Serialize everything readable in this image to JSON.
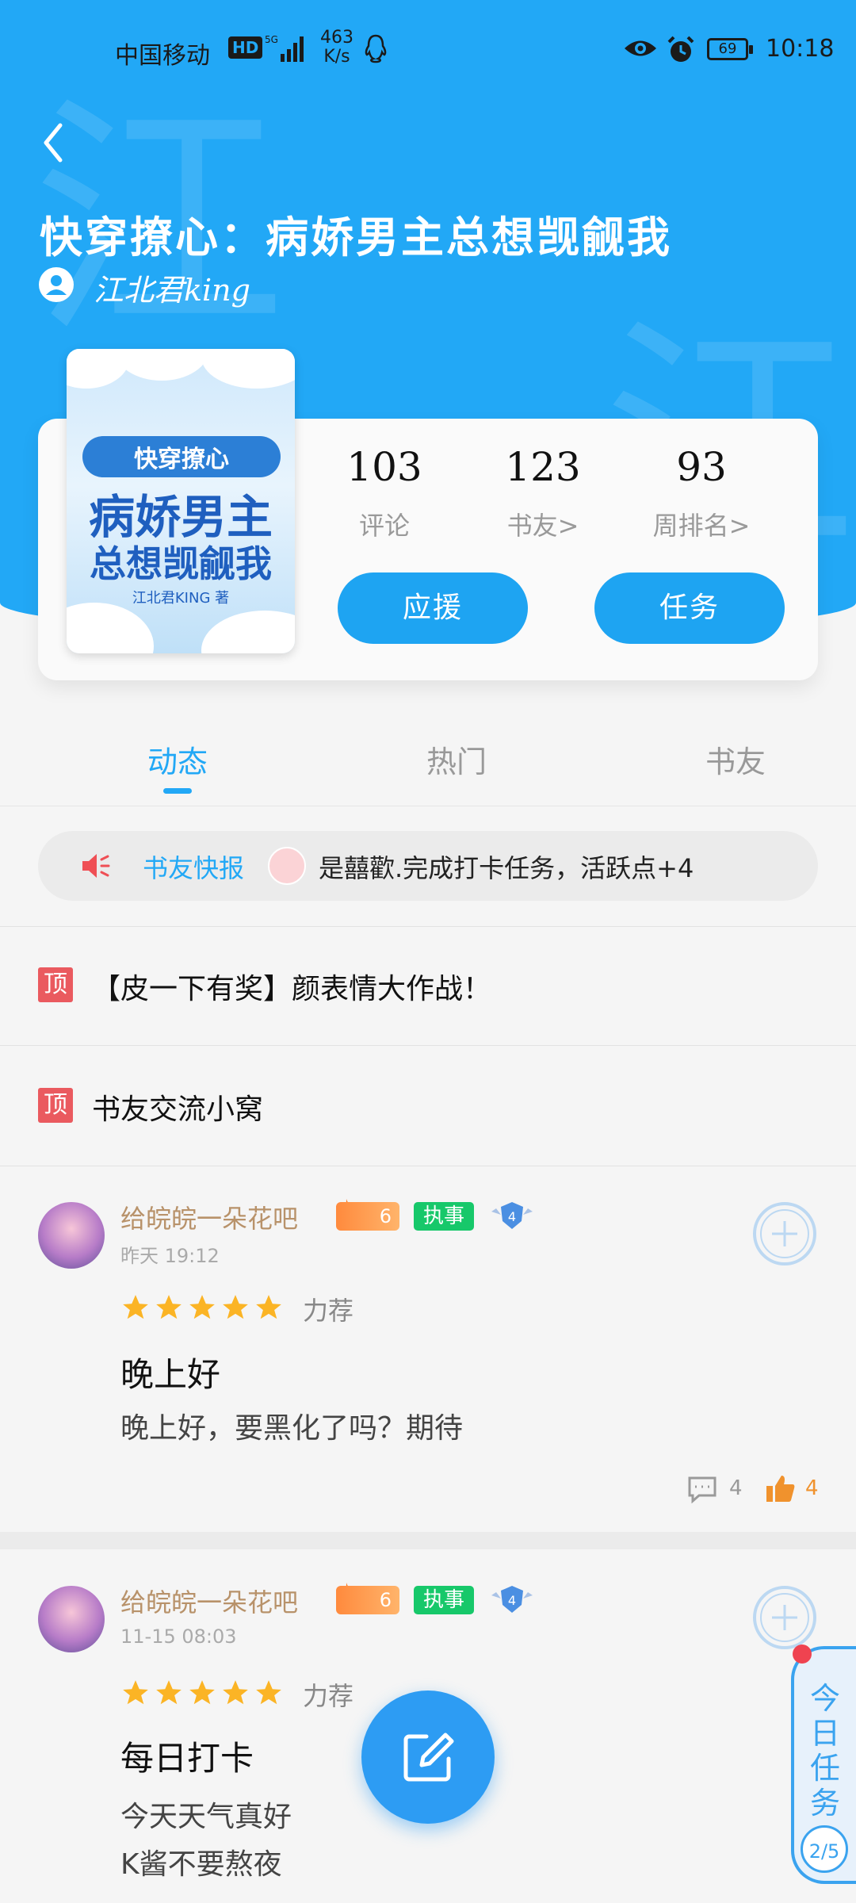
{
  "status_bar": {
    "carrier": "中国移动",
    "hd": "HD",
    "network_speed_value": "463",
    "network_speed_unit": "K/s",
    "battery": "69",
    "time": "10:18"
  },
  "book": {
    "title": "快穿撩心：病娇男主总想觊觎我",
    "author": "江北君king",
    "cover": {
      "line1": "快穿撩心",
      "line2": "病娇男主",
      "line3": "总想觊觎我",
      "line4": "江北君KING 著"
    }
  },
  "stats": [
    {
      "value": "103",
      "label": "评论"
    },
    {
      "value": "123",
      "label": "书友>"
    },
    {
      "value": "93",
      "label": "周排名>"
    }
  ],
  "actions": {
    "support_label": "应援",
    "task_label": "任务"
  },
  "tabs": [
    {
      "label": "动态",
      "active": true
    },
    {
      "label": "热门",
      "active": false
    },
    {
      "label": "书友",
      "active": false
    }
  ],
  "news": {
    "title": "书友快报",
    "text": "是囍歡.完成打卡任务，活跃点+4"
  },
  "pinned": [
    {
      "badge": "顶",
      "text": "【皮一下有奖】颜表情大作战！"
    },
    {
      "badge": "顶",
      "text": "书友交流小窝"
    }
  ],
  "posts": [
    {
      "user": "给皖皖一朵花吧",
      "level": "6",
      "badge": "执事",
      "shield_level": "4",
      "time": "昨天 19:12",
      "recommend": "力荐",
      "title": "晚上好",
      "body": [
        "晚上好，要黑化了吗？期待"
      ],
      "replies": "4",
      "likes": "4"
    },
    {
      "user": "给皖皖一朵花吧",
      "level": "6",
      "badge": "执事",
      "shield_level": "4",
      "time": "11-15 08:03",
      "recommend": "力荐",
      "title": "每日打卡",
      "body": [
        "今天天气真好",
        "K酱不要熬夜"
      ]
    }
  ],
  "daily_task": {
    "label": "今日任务",
    "progress": "2/5"
  },
  "colors": {
    "accent": "#22a8f6",
    "button": "#1ea4f2",
    "pin": "#ea5a5f",
    "exec_badge": "#17c86a",
    "like": "#f0922d",
    "username": "#b8926a"
  }
}
